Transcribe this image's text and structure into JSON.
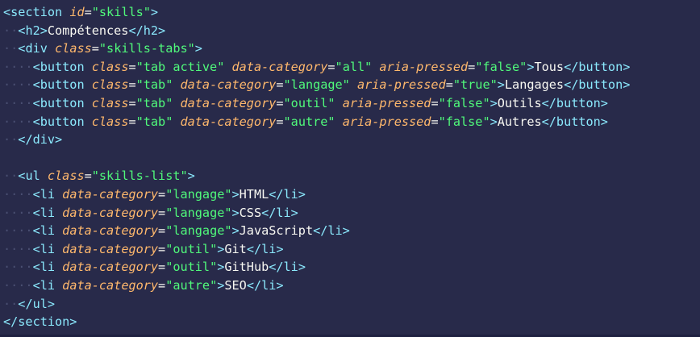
{
  "editor": {
    "language": "html",
    "colors": {
      "background": "#282a4a",
      "tag": "#8be9fd",
      "attribute": "#ffb86c",
      "string": "#50fa7b",
      "text": "#f8f8f2",
      "indent_guide": "#4a4f72"
    },
    "lines": [
      {
        "indent": "",
        "tokens": [
          [
            "tag",
            "<section"
          ],
          [
            "txt",
            " "
          ],
          [
            "attr",
            "id"
          ],
          [
            "punc",
            "="
          ],
          [
            "str",
            "\"skills\""
          ],
          [
            "tag",
            ">"
          ]
        ]
      },
      {
        "indent": "··",
        "tokens": [
          [
            "tag",
            "<h2>"
          ],
          [
            "txt",
            "Compétences"
          ],
          [
            "tag",
            "</h2>"
          ]
        ]
      },
      {
        "indent": "··",
        "tokens": [
          [
            "tag",
            "<div"
          ],
          [
            "txt",
            " "
          ],
          [
            "attr",
            "class"
          ],
          [
            "punc",
            "="
          ],
          [
            "str",
            "\"skills-tabs\""
          ],
          [
            "tag",
            ">"
          ]
        ]
      },
      {
        "indent": "····",
        "tokens": [
          [
            "tag",
            "<button"
          ],
          [
            "txt",
            " "
          ],
          [
            "attr",
            "class"
          ],
          [
            "punc",
            "="
          ],
          [
            "str",
            "\"tab active\""
          ],
          [
            "txt",
            " "
          ],
          [
            "attr",
            "data-category"
          ],
          [
            "punc",
            "="
          ],
          [
            "str",
            "\"all\""
          ],
          [
            "txt",
            " "
          ],
          [
            "attr",
            "aria-pressed"
          ],
          [
            "punc",
            "="
          ],
          [
            "str",
            "\"false\""
          ],
          [
            "tag",
            ">"
          ],
          [
            "txt",
            "Tous"
          ],
          [
            "tag",
            "</button>"
          ]
        ]
      },
      {
        "indent": "····",
        "tokens": [
          [
            "tag",
            "<button"
          ],
          [
            "txt",
            " "
          ],
          [
            "attr",
            "class"
          ],
          [
            "punc",
            "="
          ],
          [
            "str",
            "\"tab\""
          ],
          [
            "txt",
            " "
          ],
          [
            "attr",
            "data-category"
          ],
          [
            "punc",
            "="
          ],
          [
            "str",
            "\"langage\""
          ],
          [
            "txt",
            " "
          ],
          [
            "attr",
            "aria-pressed"
          ],
          [
            "punc",
            "="
          ],
          [
            "str",
            "\"true\""
          ],
          [
            "tag",
            ">"
          ],
          [
            "txt",
            "Langages"
          ],
          [
            "tag",
            "</button>"
          ]
        ]
      },
      {
        "indent": "····",
        "tokens": [
          [
            "tag",
            "<button"
          ],
          [
            "txt",
            " "
          ],
          [
            "attr",
            "class"
          ],
          [
            "punc",
            "="
          ],
          [
            "str",
            "\"tab\""
          ],
          [
            "txt",
            " "
          ],
          [
            "attr",
            "data-category"
          ],
          [
            "punc",
            "="
          ],
          [
            "str",
            "\"outil\""
          ],
          [
            "txt",
            " "
          ],
          [
            "attr",
            "aria-pressed"
          ],
          [
            "punc",
            "="
          ],
          [
            "str",
            "\"false\""
          ],
          [
            "tag",
            ">"
          ],
          [
            "txt",
            "Outils"
          ],
          [
            "tag",
            "</button>"
          ]
        ]
      },
      {
        "indent": "····",
        "tokens": [
          [
            "tag",
            "<button"
          ],
          [
            "txt",
            " "
          ],
          [
            "attr",
            "class"
          ],
          [
            "punc",
            "="
          ],
          [
            "str",
            "\"tab\""
          ],
          [
            "txt",
            " "
          ],
          [
            "attr",
            "data-category"
          ],
          [
            "punc",
            "="
          ],
          [
            "str",
            "\"autre\""
          ],
          [
            "txt",
            " "
          ],
          [
            "attr",
            "aria-pressed"
          ],
          [
            "punc",
            "="
          ],
          [
            "str",
            "\"false\""
          ],
          [
            "tag",
            ">"
          ],
          [
            "txt",
            "Autres"
          ],
          [
            "tag",
            "</button>"
          ]
        ]
      },
      {
        "indent": "··",
        "tokens": [
          [
            "tag",
            "</div>"
          ]
        ]
      },
      {
        "indent": "",
        "tokens": []
      },
      {
        "indent": "··",
        "tokens": [
          [
            "tag",
            "<ul"
          ],
          [
            "txt",
            " "
          ],
          [
            "attr",
            "class"
          ],
          [
            "punc",
            "="
          ],
          [
            "str",
            "\"skills-list\""
          ],
          [
            "tag",
            ">"
          ]
        ]
      },
      {
        "indent": "····",
        "tokens": [
          [
            "tag",
            "<li"
          ],
          [
            "txt",
            " "
          ],
          [
            "attr",
            "data-category"
          ],
          [
            "punc",
            "="
          ],
          [
            "str",
            "\"langage\""
          ],
          [
            "tag",
            ">"
          ],
          [
            "txt",
            "HTML"
          ],
          [
            "tag",
            "</li>"
          ]
        ]
      },
      {
        "indent": "····",
        "tokens": [
          [
            "tag",
            "<li"
          ],
          [
            "txt",
            " "
          ],
          [
            "attr",
            "data-category"
          ],
          [
            "punc",
            "="
          ],
          [
            "str",
            "\"langage\""
          ],
          [
            "tag",
            ">"
          ],
          [
            "txt",
            "CSS"
          ],
          [
            "tag",
            "</li>"
          ]
        ]
      },
      {
        "indent": "····",
        "tokens": [
          [
            "tag",
            "<li"
          ],
          [
            "txt",
            " "
          ],
          [
            "attr",
            "data-category"
          ],
          [
            "punc",
            "="
          ],
          [
            "str",
            "\"langage\""
          ],
          [
            "tag",
            ">"
          ],
          [
            "txt",
            "JavaScript"
          ],
          [
            "tag",
            "</li>"
          ]
        ]
      },
      {
        "indent": "····",
        "tokens": [
          [
            "tag",
            "<li"
          ],
          [
            "txt",
            " "
          ],
          [
            "attr",
            "data-category"
          ],
          [
            "punc",
            "="
          ],
          [
            "str",
            "\"outil\""
          ],
          [
            "tag",
            ">"
          ],
          [
            "txt",
            "Git"
          ],
          [
            "tag",
            "</li>"
          ]
        ]
      },
      {
        "indent": "····",
        "tokens": [
          [
            "tag",
            "<li"
          ],
          [
            "txt",
            " "
          ],
          [
            "attr",
            "data-category"
          ],
          [
            "punc",
            "="
          ],
          [
            "str",
            "\"outil\""
          ],
          [
            "tag",
            ">"
          ],
          [
            "txt",
            "GitHub"
          ],
          [
            "tag",
            "</li>"
          ]
        ]
      },
      {
        "indent": "····",
        "tokens": [
          [
            "tag",
            "<li"
          ],
          [
            "txt",
            " "
          ],
          [
            "attr",
            "data-category"
          ],
          [
            "punc",
            "="
          ],
          [
            "str",
            "\"autre\""
          ],
          [
            "tag",
            ">"
          ],
          [
            "txt",
            "SEO"
          ],
          [
            "tag",
            "</li>"
          ]
        ]
      },
      {
        "indent": "··",
        "tokens": [
          [
            "tag",
            "</ul>"
          ]
        ]
      },
      {
        "indent": "",
        "tokens": [
          [
            "tag",
            "</section>"
          ]
        ]
      }
    ]
  }
}
